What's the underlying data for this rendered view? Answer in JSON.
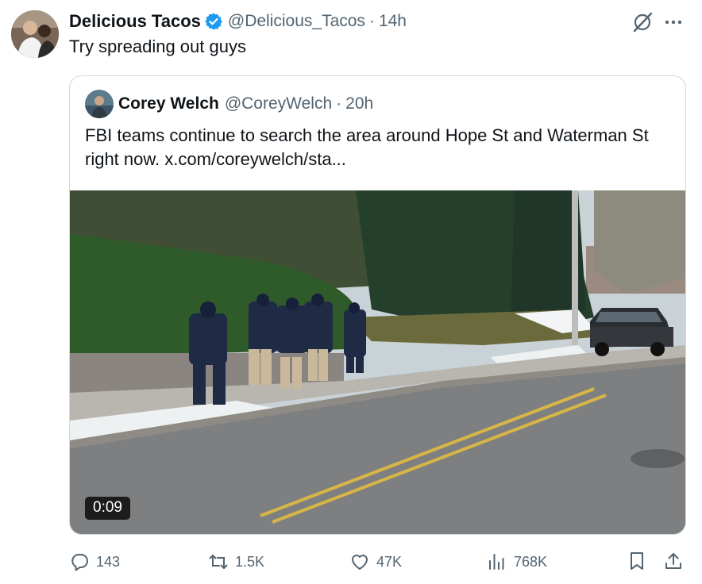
{
  "tweet": {
    "author_name": "Delicious Tacos",
    "author_handle": "@Delicious_Tacos",
    "separator": "·",
    "time": "14h",
    "text": "Try spreading out guys",
    "verified": true
  },
  "quoted_tweet": {
    "author_name": "Corey Welch",
    "author_handle": "@CoreyWelch",
    "separator": "·",
    "time": "20h",
    "text": "FBI teams continue to search the area around Hope St and Waterman St right now.  x.com/coreywelch/sta...",
    "video_duration": "0:09"
  },
  "actions": {
    "replies": "143",
    "reposts": "1.5K",
    "likes": "47K",
    "views": "768K"
  },
  "icons": [
    "verified-badge-icon",
    "grok-icon",
    "more-icon",
    "reply-icon",
    "repost-icon",
    "like-icon",
    "views-icon",
    "bookmark-icon",
    "share-icon"
  ],
  "colors": {
    "verified": "#1d9bf0",
    "secondary_text": "#536471",
    "border": "#cfd9de"
  }
}
